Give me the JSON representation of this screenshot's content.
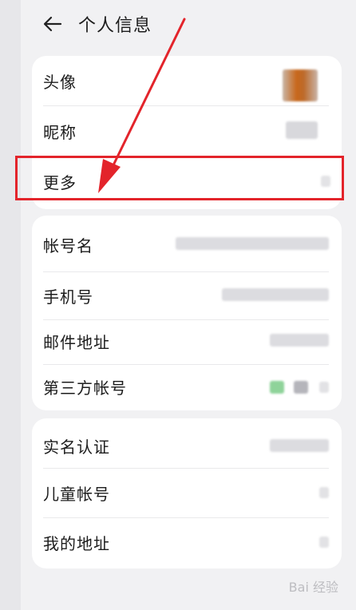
{
  "header": {
    "title": "个人信息",
    "back_icon": "arrow-left-icon"
  },
  "sections": [
    {
      "rows": [
        {
          "label": "头像"
        },
        {
          "label": "昵称"
        },
        {
          "label": "更多"
        }
      ]
    },
    {
      "rows": [
        {
          "label": "帐号名"
        },
        {
          "label": "手机号"
        },
        {
          "label": "邮件地址"
        },
        {
          "label": "第三方帐号"
        }
      ]
    },
    {
      "rows": [
        {
          "label": "实名认证"
        },
        {
          "label": "儿童帐号"
        },
        {
          "label": "我的地址"
        }
      ]
    }
  ],
  "annotation": {
    "highlight_color": "#e3242b",
    "arrow_color": "#e3242b"
  },
  "watermark": "Bai 经验"
}
